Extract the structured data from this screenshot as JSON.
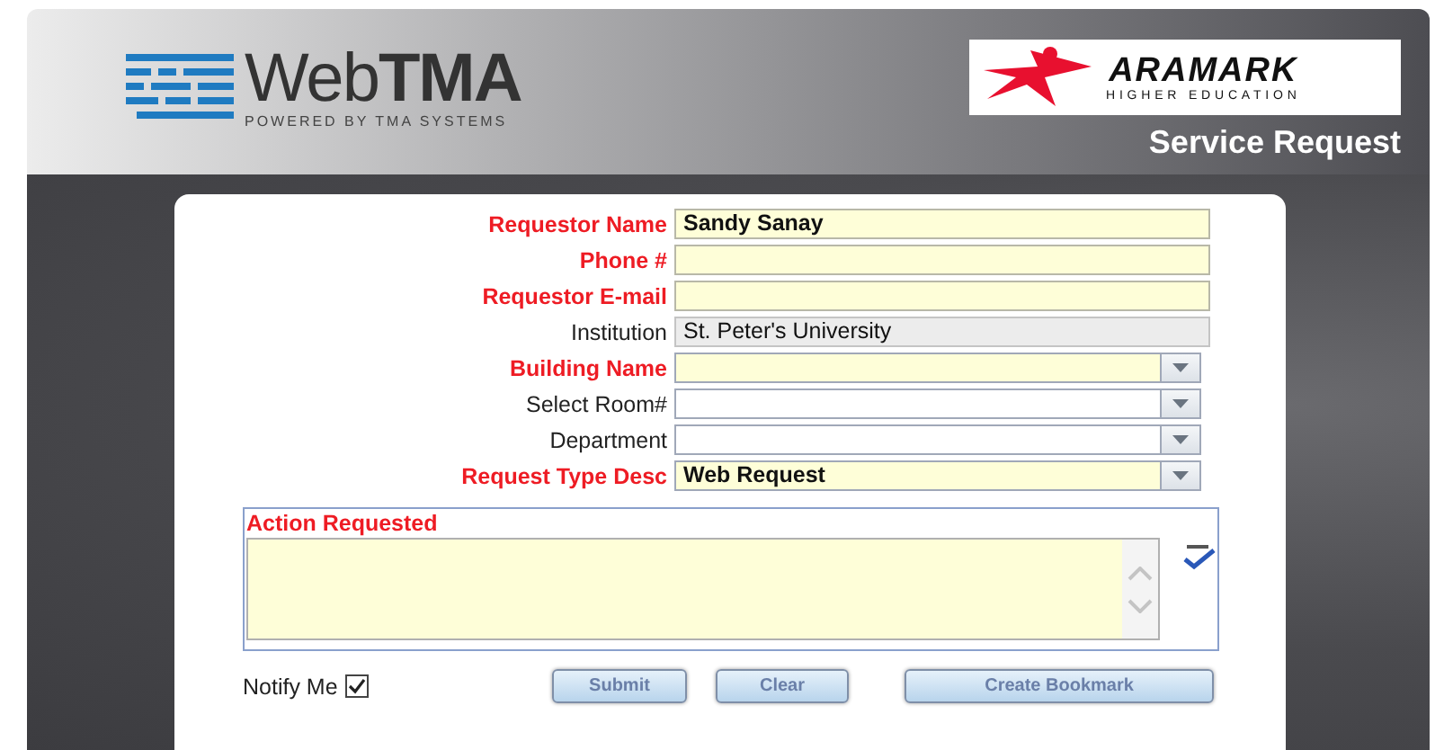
{
  "header": {
    "brand": "Web**TMA**",
    "tagline": "POWERED BY TMA SYSTEMS",
    "partner_name": "ARAMARK",
    "partner_sub": "HIGHER EDUCATION",
    "title": "Service Request"
  },
  "fields": [
    {
      "label": "Requestor Name",
      "kind": "text",
      "required": true,
      "value": "Sandy Sanay"
    },
    {
      "label": "Phone #",
      "kind": "text",
      "required": true
    },
    {
      "label": "Requestor E-mail",
      "kind": "text",
      "required": true
    },
    {
      "label": "Institution",
      "kind": "readonly",
      "required": false,
      "value": "St. Peter's University"
    },
    {
      "label": "Building Name",
      "kind": "select",
      "required": true
    },
    {
      "label": "Select Room#",
      "kind": "select",
      "required": false
    },
    {
      "label": "Department",
      "kind": "select",
      "required": false
    },
    {
      "label": "Request Type Desc",
      "kind": "select",
      "required": true,
      "value": "Web Request"
    }
  ],
  "action": {
    "label": "Action Requested",
    "required": true
  },
  "notify": {
    "label": "Notify Me",
    "checked": true
  },
  "buttons": [
    "Submit",
    "Clear",
    "Create Bookmark"
  ]
}
